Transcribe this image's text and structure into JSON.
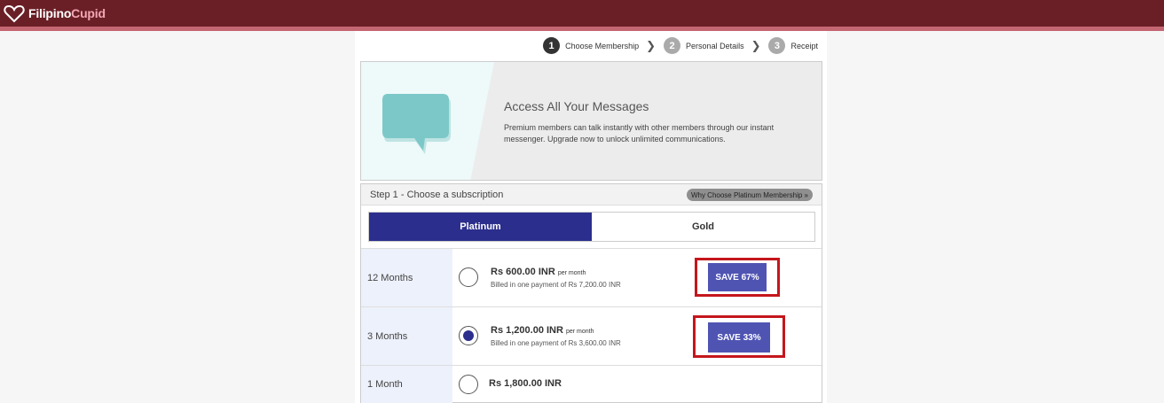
{
  "brand": {
    "name_part1": "Filipino",
    "name_part2": "Cupid",
    "accent": "#6a1f26",
    "stripe": "#c46672"
  },
  "steps": [
    {
      "number": "1",
      "label": "Choose Membership",
      "active": true
    },
    {
      "number": "2",
      "label": "Personal Details",
      "active": false
    },
    {
      "number": "3",
      "label": "Receipt",
      "active": false
    }
  ],
  "step_arrow": "❯",
  "hero": {
    "icon": "chat-bubble-icon",
    "title": "Access All Your Messages",
    "text": "Premium members can talk instantly with other members through our instant messenger. Upgrade now to unlock unlimited communications."
  },
  "subscription": {
    "header": "Step 1 - Choose a subscription",
    "why_button": "Why Choose Platinum Membership »",
    "tabs": [
      {
        "label": "Platinum",
        "active": true
      },
      {
        "label": "Gold",
        "active": false
      }
    ],
    "plans": [
      {
        "duration": "12 Months",
        "price": "Rs 600.00 INR",
        "per": "per month",
        "billed": "Billed in one payment of Rs 7,200.00 INR",
        "save": "SAVE 67%",
        "selected": false
      },
      {
        "duration": "3 Months",
        "price": "Rs 1,200.00 INR",
        "per": "per month",
        "billed": "Billed in one payment of Rs 3,600.00 INR",
        "save": "SAVE 33%",
        "selected": true
      },
      {
        "duration": "1 Month",
        "price": "Rs 1,800.00 INR",
        "per": "",
        "billed": "",
        "save": "",
        "selected": false
      }
    ],
    "colors": {
      "primary": "#2b2e8c",
      "save": "#4f54b3",
      "highlight": "#c4161c"
    }
  }
}
